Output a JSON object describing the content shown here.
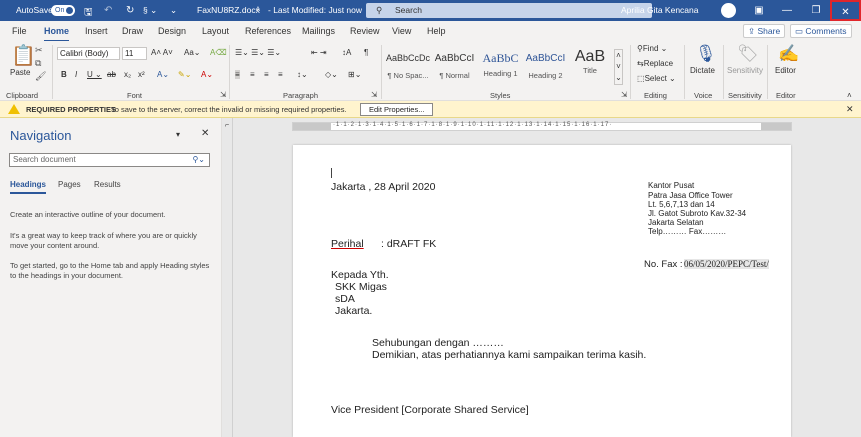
{
  "titlebar": {
    "autosave_label": "AutoSave",
    "autosave_state": "On",
    "filename": "FaxNU8RZ.docx",
    "modified": "- Last Modified: Just now",
    "search_placeholder": "Search",
    "user_name": "Aprilia Gita Kencana"
  },
  "tabs": [
    "File",
    "Home",
    "Insert",
    "Draw",
    "Design",
    "Layout",
    "References",
    "Mailings",
    "Review",
    "View",
    "Help"
  ],
  "share_label": "Share",
  "comments_label": "Comments",
  "ribbon": {
    "paste_label": "Paste",
    "font_name": "Calibri (Body)",
    "font_size": "11",
    "styles": [
      {
        "preview": "AaBbCcDc",
        "name": "¶ No Spac..."
      },
      {
        "preview": "AaBbCcI",
        "name": "¶ Normal"
      },
      {
        "preview": "AaBbC",
        "name": "Heading 1"
      },
      {
        "preview": "AaBbCcI",
        "name": "Heading 2"
      },
      {
        "preview": "AaB",
        "name": "Title"
      }
    ],
    "find_label": "Find",
    "replace_label": "Replace",
    "select_label": "Select",
    "dictate_label": "Dictate",
    "sensitivity_label": "Sensitivity",
    "editor_label": "Editor",
    "groups": {
      "clipboard": "Clipboard",
      "font": "Font",
      "paragraph": "Paragraph",
      "styles": "Styles",
      "editing": "Editing",
      "voice": "Voice",
      "sensitivity": "Sensitivity",
      "editor": "Editor"
    }
  },
  "infobar": {
    "title": "REQUIRED PROPERTIES",
    "message": "To save to the server, correct the invalid or missing required properties.",
    "button": "Edit Properties..."
  },
  "navigation": {
    "title": "Navigation",
    "search_placeholder": "Search document",
    "tabs": [
      "Headings",
      "Pages",
      "Results"
    ],
    "p1": "Create an interactive outline of your document.",
    "p2": "It's a great way to keep track of where you are or quickly move your content around.",
    "p3": "To get started, go to the Home tab and apply Heading styles to the headings in your document."
  },
  "document": {
    "date_line": "Jakarta , 28 April 2020",
    "addr": [
      "Kantor Pusat",
      "Patra Jasa Office Tower",
      "Lt. 5,6,7,13 dan 14",
      "Jl. Gatot Subroto Kav.32-34",
      "Jakarta Selatan",
      "Telp……… Fax………"
    ],
    "perihal_label": "Perihal",
    "perihal_value": ":    dRAFT FK",
    "fax_label": "No. Fax :",
    "fax_value": "06/05/2020/PEPC/Test/",
    "kepada": [
      "Kepada Yth.",
      "SKK Migas",
      "sDA",
      "Jakarta."
    ],
    "body1": "Sehubungan dengan ………",
    "body2": "Demikian, atas perhatiannya kami sampaikan terima kasih.",
    "signature": "Vice President [Corporate Shared Service]"
  }
}
